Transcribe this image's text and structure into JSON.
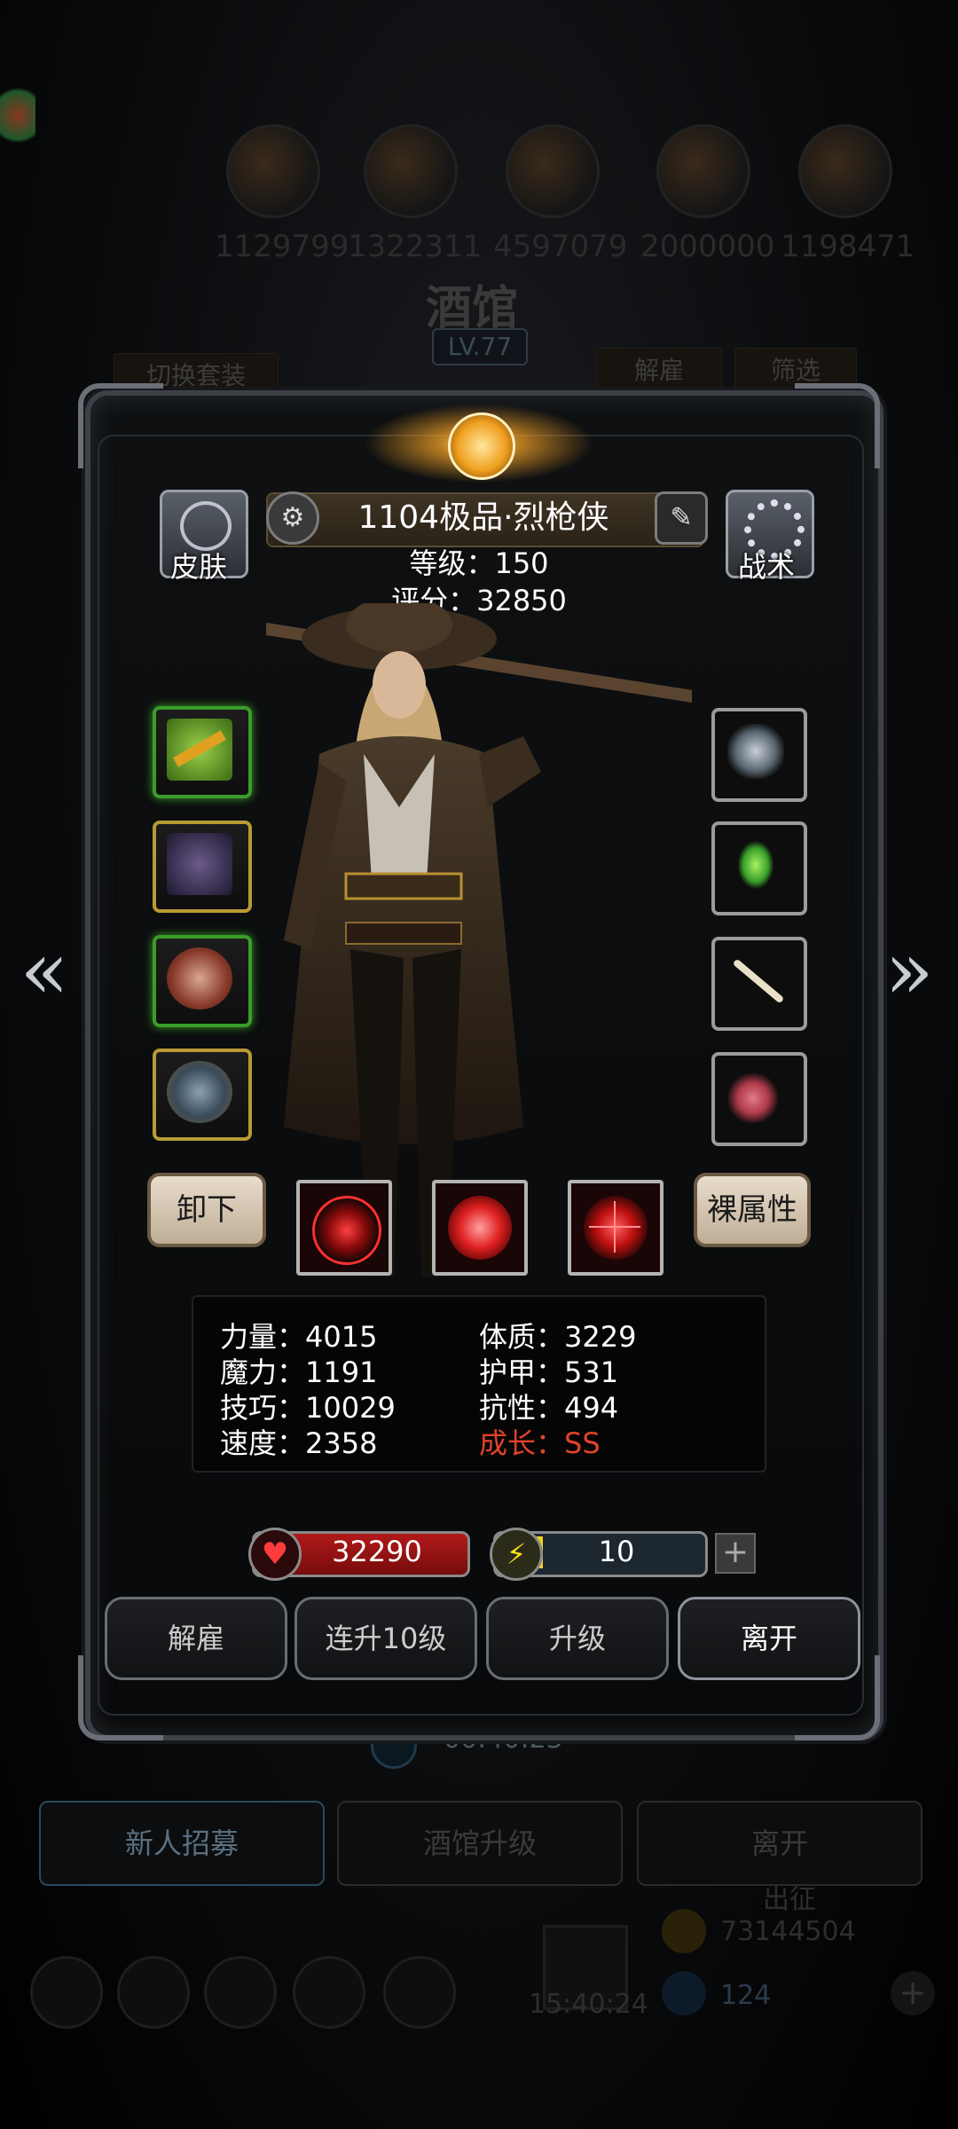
{
  "background": {
    "resources": [
      "1129799",
      "1322311",
      "4597079",
      "2000000",
      "1198471"
    ],
    "title": "酒馆",
    "level": "LV.77",
    "buttons": {
      "switch_outfit": "切换套装",
      "dismiss": "解雇",
      "filter": "筛选"
    },
    "timer": "00:40:23",
    "bottom_tabs": [
      "新人招募",
      "酒馆升级",
      "离开"
    ],
    "expedition": "出征",
    "gold": "73144504",
    "gems": "124",
    "clock": "15:40:24"
  },
  "hero": {
    "name": "1104极品·烈枪侠",
    "level_label": "等级：150",
    "score_label": "评分：32850",
    "skin_label": "皮肤",
    "tactics_label": "战术"
  },
  "equipment_left": [
    {
      "name": "golden-shotgun",
      "rarity": "green",
      "color": "#d98a12"
    },
    {
      "name": "purple-coat",
      "rarity": "yellow",
      "color": "#4a3a6a"
    },
    {
      "name": "ornate-amulet",
      "rarity": "green",
      "color": "#b46a4a"
    },
    {
      "name": "gem-ring",
      "rarity": "yellow",
      "color": "#5a7080"
    }
  ],
  "equipment_right": [
    {
      "name": "cloud-ring",
      "color": "#8a9aa8"
    },
    {
      "name": "green-crystal",
      "color": "#3aa02a"
    },
    {
      "name": "bone-stick",
      "color": "#d8d0b8"
    },
    {
      "name": "pink-orb",
      "color": "#b03a4a"
    }
  ],
  "actions": {
    "unequip": "卸下",
    "base_attr": "裸属性"
  },
  "stats": {
    "str": "力量：4015",
    "con": "体质：3229",
    "mag": "魔力：1191",
    "armor": "护甲：531",
    "skill": "技巧：10029",
    "resist": "抗性：494",
    "speed": "速度：2358",
    "growth": "成长：SS"
  },
  "hp": "32290",
  "energy": "10",
  "energy_plus": "+",
  "buttons": [
    "解雇",
    "连升10级",
    "升级",
    "离开"
  ],
  "colors": {
    "growth": "#e0432a",
    "hp": "#b21919",
    "energy": "#f2d21c"
  }
}
